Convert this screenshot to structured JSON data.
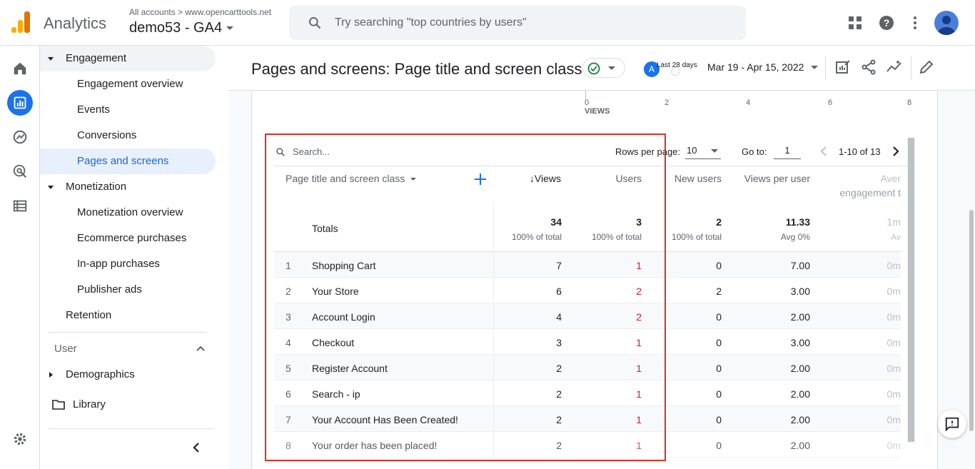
{
  "topbar": {
    "brand": "Analytics",
    "breadcrumb": "All accounts > www.opencarttools.net",
    "property": "demo53 - GA4",
    "search_placeholder": "Try searching \"top countries by users\"",
    "avatar_letter": "",
    "colors": {
      "logo": "#f9ab00",
      "accent": "#1a73e8"
    }
  },
  "nav": {
    "engagement": "Engagement",
    "engagement_items": [
      "Engagement overview",
      "Events",
      "Conversions",
      "Pages and screens"
    ],
    "monetization": "Monetization",
    "monetization_items": [
      "Monetization overview",
      "Ecommerce purchases",
      "In-app purchases",
      "Publisher ads"
    ],
    "retention": "Retention",
    "user_section": "User",
    "demographics": "Demographics",
    "library": "Library"
  },
  "report": {
    "title": "Pages and screens: Page title and screen class",
    "date_badge": "Last 28 days",
    "date_range": "Mar 19 - Apr 15, 2022",
    "axis_ticks": [
      "0",
      "2",
      "4",
      "6",
      "8"
    ],
    "axis_label": "VIEWS"
  },
  "table": {
    "search_placeholder": "Search...",
    "rows_per_page_label": "Rows per page:",
    "rows_per_page_value": "10",
    "goto_label": "Go to:",
    "goto_value": "1",
    "range": "1-10 of 13",
    "columns": {
      "dimension": "Page title and screen class",
      "views": "↓Views",
      "users": "Users",
      "new_users": "New users",
      "views_per_user": "Views per user",
      "avg_engagement_a": "Aver",
      "avg_engagement_b": "engagement t"
    },
    "totals": {
      "label": "Totals",
      "views": "34",
      "views_sub": "100% of total",
      "users": "3",
      "users_sub": "100% of total",
      "new_users": "2",
      "new_users_sub": "100% of total",
      "vpu": "11.33",
      "vpu_sub": "Avg 0%",
      "eng": "1m",
      "eng_sub": "Av"
    },
    "rows": [
      {
        "idx": "1",
        "name": "Shopping Cart",
        "views": "7",
        "users": "1",
        "new_users": "0",
        "vpu": "7.00",
        "eng": "0m"
      },
      {
        "idx": "2",
        "name": "Your Store",
        "views": "6",
        "users": "2",
        "new_users": "2",
        "vpu": "3.00",
        "eng": "0m"
      },
      {
        "idx": "3",
        "name": "Account Login",
        "views": "4",
        "users": "2",
        "new_users": "0",
        "vpu": "2.00",
        "eng": "0m"
      },
      {
        "idx": "4",
        "name": "Checkout",
        "views": "3",
        "users": "1",
        "new_users": "0",
        "vpu": "3.00",
        "eng": "0m"
      },
      {
        "idx": "5",
        "name": "Register Account",
        "views": "2",
        "users": "1",
        "new_users": "0",
        "vpu": "2.00",
        "eng": "0m"
      },
      {
        "idx": "6",
        "name": "Search - ip",
        "views": "2",
        "users": "1",
        "new_users": "0",
        "vpu": "2.00",
        "eng": "0m"
      },
      {
        "idx": "7",
        "name": "Your Account Has Been Created!",
        "views": "2",
        "users": "1",
        "new_users": "0",
        "vpu": "2.00",
        "eng": "0m"
      },
      {
        "idx": "8",
        "name": "Your order has been placed!",
        "views": "2",
        "users": "1",
        "new_users": "0",
        "vpu": "2.00",
        "eng": "0m"
      }
    ]
  }
}
